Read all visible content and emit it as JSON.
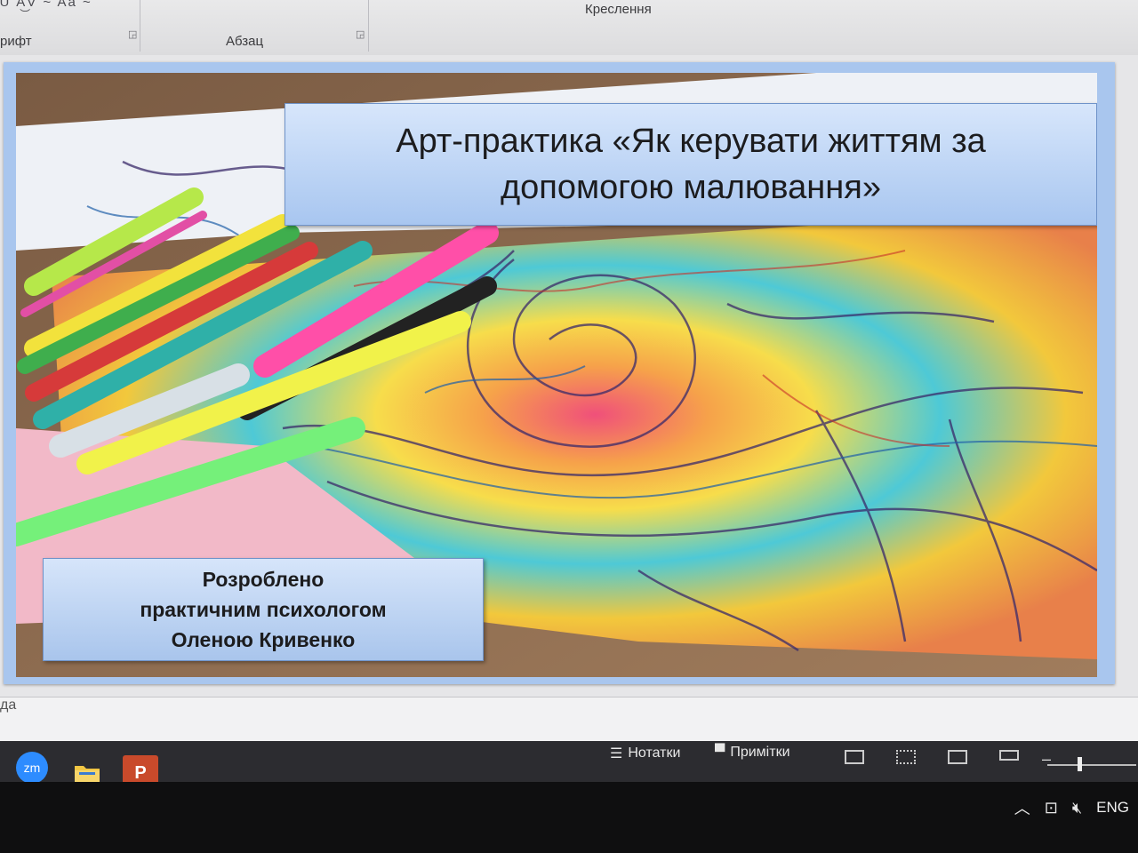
{
  "ribbon": {
    "tools_glyphs": "Ꮜ  A͜V ~  Aa ~",
    "group_font": "рифт",
    "group_paragraph": "Абзац",
    "group_drawing": "Креслення"
  },
  "slide": {
    "title": "Арт-практика «Як керувати життям за допомогою малювання»",
    "author": {
      "line1": "Розроблено",
      "line2": "практичним психологом",
      "line3": "Оленою Кривенко"
    }
  },
  "notes_hint": "да",
  "statusbar": {
    "notes_label": "Нотатки",
    "comments_label": "Примітки"
  },
  "taskbar": {
    "apps": [
      "zm",
      "folder",
      "P"
    ],
    "language": "ENG"
  },
  "colors": {
    "title_box_top": "#d7e6fb",
    "title_box_bottom": "#a8c6f0",
    "slide_border": "#a9c6ee",
    "taskbar": "#2c2c30"
  },
  "icons": [
    "notes-icon",
    "comments-icon",
    "normal-view-icon",
    "slide-sorter-icon",
    "reading-view-icon",
    "slideshow-icon",
    "chevron-up-icon",
    "network-icon",
    "volume-muted-icon"
  ]
}
